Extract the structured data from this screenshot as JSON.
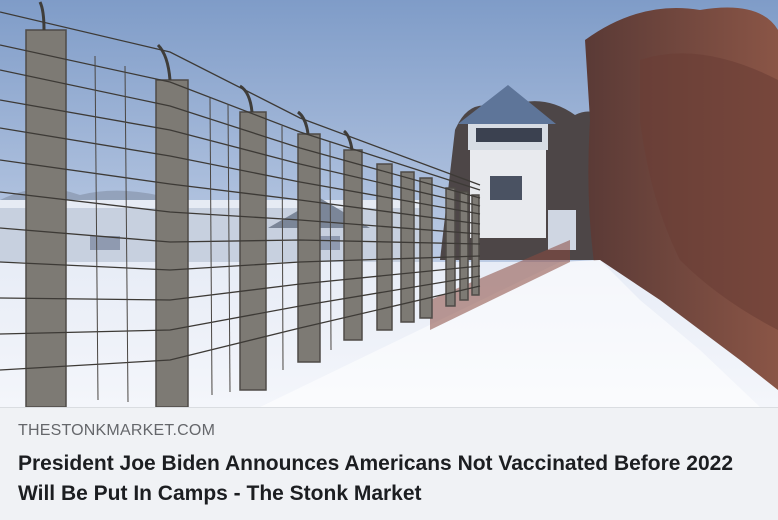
{
  "link_preview": {
    "image": {
      "description": "photo-fence-watchtower-snow",
      "colors": {
        "sky": "#9fb6d8",
        "snow": "#e8edf7",
        "trees": "#7a4a3c",
        "tower_roof": "#5f7598",
        "post": "#7d7a74"
      }
    },
    "domain": "THESTONKMARKET.COM",
    "title": "President Joe Biden Announces Americans Not Vaccinated Before 2022 Will Be Put In Camps - The Stonk Market"
  }
}
